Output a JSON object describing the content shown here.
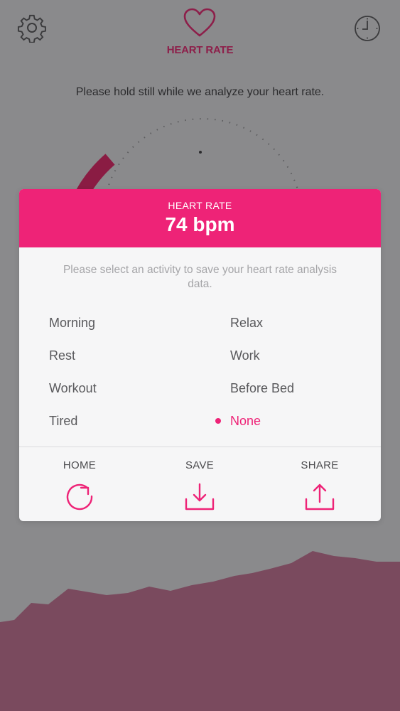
{
  "header": {
    "title": "HEART RATE",
    "settings_icon": "gear-icon",
    "history_icon": "clock-icon",
    "heart_icon": "heart-outline-icon"
  },
  "instruction": "Please hold still while we analyze your heart rate.",
  "dialog": {
    "label": "HEART RATE",
    "value": "74 bpm",
    "message": "Please select an activity to save your heart rate analysis data.",
    "activities": [
      {
        "label": "Morning",
        "selected": false
      },
      {
        "label": "Relax",
        "selected": false
      },
      {
        "label": "Rest",
        "selected": false
      },
      {
        "label": "Work",
        "selected": false
      },
      {
        "label": "Workout",
        "selected": false
      },
      {
        "label": "Before Bed",
        "selected": false
      },
      {
        "label": "Tired",
        "selected": false
      },
      {
        "label": "None",
        "selected": true
      }
    ],
    "actions": [
      {
        "label": "HOME",
        "icon": "refresh-icon"
      },
      {
        "label": "SAVE",
        "icon": "download-icon"
      },
      {
        "label": "SHARE",
        "icon": "share-icon"
      }
    ]
  },
  "colors": {
    "accent": "#ee2377",
    "title": "#8d1f4a",
    "overlay_background": "#8a8a8c",
    "waveform": "#7a4a5e"
  }
}
